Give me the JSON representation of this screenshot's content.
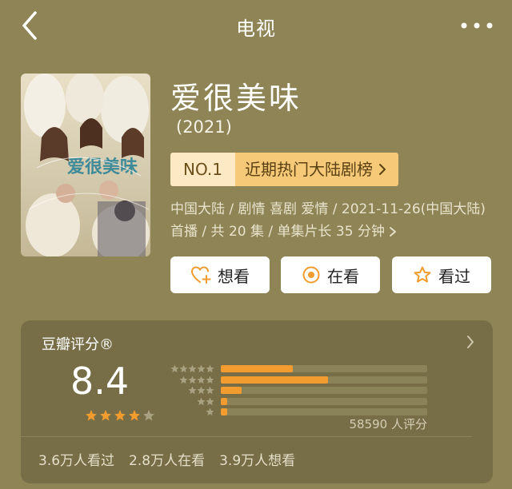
{
  "nav": {
    "title": "电视",
    "back_icon": "chevron-left-icon",
    "more_icon": "more-horizontal-icon"
  },
  "show": {
    "title": "爱很美味",
    "year": "(2021)",
    "rank_no": "NO.1",
    "rank_name": "近期热门大陆剧榜",
    "info": "中国大陆 / 剧情 喜剧 爱情 / 2021-11-26(中国大陆) 首播 / 共 20 集 / 单集片长 35 分钟",
    "poster_title": "爱很美味"
  },
  "actions": {
    "want": "想看",
    "watching": "在看",
    "watched": "看过"
  },
  "rating": {
    "label": "豆瓣评分®",
    "score": "8.4",
    "stars_filled": 4,
    "stars_total": 5,
    "raters": "58590 人评分",
    "distribution": [
      0.35,
      0.52,
      0.1,
      0.03,
      0.03
    ],
    "stats": [
      "3.6万人看过",
      "2.8万人在看",
      "3.9万人想看"
    ]
  },
  "colors": {
    "background": "#8e8455",
    "accent": "#f29b2e",
    "rank_badge": "#f5c978"
  }
}
